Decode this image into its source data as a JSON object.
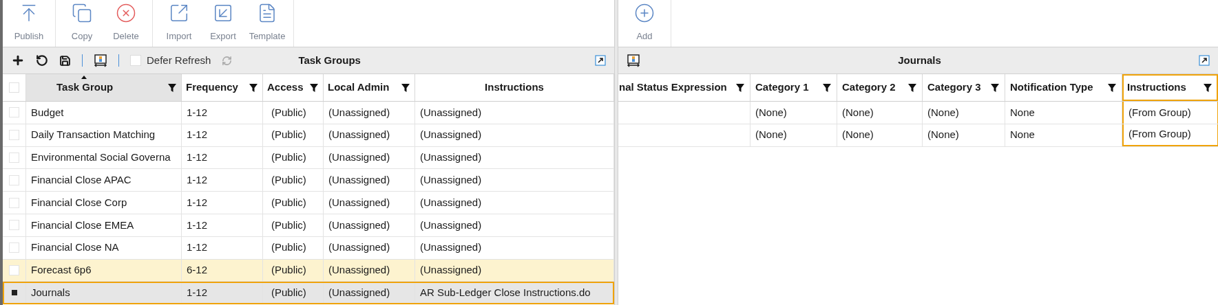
{
  "left_toolbar": {
    "groups": [
      [
        {
          "label": "Publish",
          "kind": "publish"
        }
      ],
      [
        {
          "label": "Copy",
          "kind": "copy"
        },
        {
          "label": "Delete",
          "kind": "delete"
        }
      ],
      [
        {
          "label": "Import",
          "kind": "import"
        },
        {
          "label": "Export",
          "kind": "export"
        },
        {
          "label": "Template",
          "kind": "template"
        }
      ]
    ]
  },
  "right_toolbar": {
    "groups": [
      [
        {
          "label": "Add",
          "kind": "add"
        }
      ]
    ]
  },
  "task_groups": {
    "title": "Task Groups",
    "defer_refresh": {
      "label": "Defer Refresh",
      "checked": false
    },
    "select_all": {
      "checked": false
    },
    "columns": [
      {
        "label": "Task Group",
        "filter": true,
        "sorted": true
      },
      {
        "label": "Frequency",
        "filter": true,
        "sorted": false
      },
      {
        "label": "Access",
        "filter": true,
        "sorted": false
      },
      {
        "label": "Local Admin",
        "filter": true,
        "sorted": false
      },
      {
        "label": "Instructions",
        "filter": false,
        "sorted": false
      }
    ],
    "rows": [
      {
        "cells": [
          "Budget",
          "1-12",
          "(Public)",
          "(Unassigned)",
          "(Unassigned)"
        ],
        "selected": false,
        "hovered": false,
        "highlighted": false
      },
      {
        "cells": [
          "Daily Transaction Matching",
          "1-12",
          "(Public)",
          "(Unassigned)",
          "(Unassigned)"
        ],
        "selected": false,
        "hovered": false,
        "highlighted": false
      },
      {
        "cells": [
          "Environmental Social Governa",
          "1-12",
          "(Public)",
          "(Unassigned)",
          "(Unassigned)"
        ],
        "selected": false,
        "hovered": false,
        "highlighted": false
      },
      {
        "cells": [
          "Financial Close APAC",
          "1-12",
          "(Public)",
          "(Unassigned)",
          "(Unassigned)"
        ],
        "selected": false,
        "hovered": false,
        "highlighted": false
      },
      {
        "cells": [
          "Financial Close Corp",
          "1-12",
          "(Public)",
          "(Unassigned)",
          "(Unassigned)"
        ],
        "selected": false,
        "hovered": false,
        "highlighted": false
      },
      {
        "cells": [
          "Financial Close EMEA",
          "1-12",
          "(Public)",
          "(Unassigned)",
          "(Unassigned)"
        ],
        "selected": false,
        "hovered": false,
        "highlighted": false
      },
      {
        "cells": [
          "Financial Close NA",
          "1-12",
          "(Public)",
          "(Unassigned)",
          "(Unassigned)"
        ],
        "selected": false,
        "hovered": false,
        "highlighted": false
      },
      {
        "cells": [
          "Forecast 6p6",
          "6-12",
          "(Public)",
          "(Unassigned)",
          "(Unassigned)"
        ],
        "selected": false,
        "hovered": true,
        "highlighted": false
      },
      {
        "cells": [
          "Journals",
          "1-12",
          "(Public)",
          "(Unassigned)",
          "AR Sub-Ledger Close Instructions.do"
        ],
        "selected": true,
        "hovered": false,
        "highlighted": true
      }
    ]
  },
  "journals": {
    "title": "Journals",
    "columns": [
      {
        "label": "nal Status Expression",
        "filter": true,
        "highlighted": false
      },
      {
        "label": "Category 1",
        "filter": true,
        "highlighted": false
      },
      {
        "label": "Category 2",
        "filter": true,
        "highlighted": false
      },
      {
        "label": "Category 3",
        "filter": true,
        "highlighted": false
      },
      {
        "label": "Notification Type",
        "filter": true,
        "highlighted": false
      },
      {
        "label": "Instructions",
        "filter": true,
        "highlighted": true
      }
    ],
    "rows": [
      {
        "cells": [
          null,
          "(None)",
          "(None)",
          "(None)",
          "None",
          "(From Group)"
        ]
      },
      {
        "cells": [
          null,
          "(None)",
          "(None)",
          "(None)",
          "None",
          "(From Group)"
        ]
      }
    ]
  }
}
